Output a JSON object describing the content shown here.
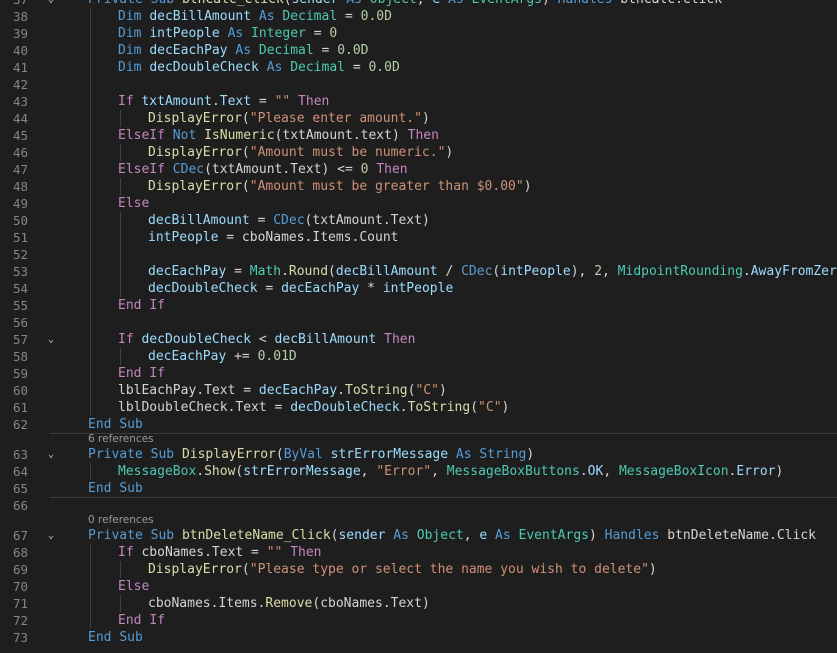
{
  "editor": {
    "lines": [
      {
        "kind": "code",
        "ln": "37",
        "fold": "v",
        "indent": 1,
        "tokens": [
          [
            "kw",
            "Private"
          ],
          [
            "pl",
            " "
          ],
          [
            "kw",
            "Sub"
          ],
          [
            "pl",
            " "
          ],
          [
            "fn",
            "btnCalc_Click"
          ],
          [
            "pl",
            "("
          ],
          [
            "var",
            "sender"
          ],
          [
            "pl",
            " "
          ],
          [
            "kw",
            "As"
          ],
          [
            "pl",
            " "
          ],
          [
            "ty",
            "Object"
          ],
          [
            "pl",
            ", "
          ],
          [
            "var",
            "e"
          ],
          [
            "pl",
            " "
          ],
          [
            "kw",
            "As"
          ],
          [
            "pl",
            " "
          ],
          [
            "ty",
            "EventArgs"
          ],
          [
            "pl",
            ") "
          ],
          [
            "kw",
            "Handles"
          ],
          [
            "pl",
            " btnCalc.Click"
          ]
        ]
      },
      {
        "kind": "code",
        "ln": "38",
        "fold": "",
        "indent": 2,
        "tokens": [
          [
            "kw",
            "Dim"
          ],
          [
            "pl",
            " "
          ],
          [
            "var",
            "decBillAmount"
          ],
          [
            "pl",
            " "
          ],
          [
            "kw",
            "As"
          ],
          [
            "pl",
            " "
          ],
          [
            "ty",
            "Decimal"
          ],
          [
            "pl",
            " = "
          ],
          [
            "num",
            "0.0D"
          ]
        ]
      },
      {
        "kind": "code",
        "ln": "39",
        "fold": "",
        "indent": 2,
        "tokens": [
          [
            "kw",
            "Dim"
          ],
          [
            "pl",
            " "
          ],
          [
            "var",
            "intPeople"
          ],
          [
            "pl",
            " "
          ],
          [
            "kw",
            "As"
          ],
          [
            "pl",
            " "
          ],
          [
            "ty",
            "Integer"
          ],
          [
            "pl",
            " = "
          ],
          [
            "num",
            "0"
          ]
        ]
      },
      {
        "kind": "code",
        "ln": "40",
        "fold": "",
        "indent": 2,
        "tokens": [
          [
            "kw",
            "Dim"
          ],
          [
            "pl",
            " "
          ],
          [
            "var",
            "decEachPay"
          ],
          [
            "pl",
            " "
          ],
          [
            "kw",
            "As"
          ],
          [
            "pl",
            " "
          ],
          [
            "ty",
            "Decimal"
          ],
          [
            "pl",
            " = "
          ],
          [
            "num",
            "0.0D"
          ]
        ]
      },
      {
        "kind": "code",
        "ln": "41",
        "fold": "",
        "indent": 2,
        "tokens": [
          [
            "kw",
            "Dim"
          ],
          [
            "pl",
            " "
          ],
          [
            "var",
            "decDoubleCheck"
          ],
          [
            "pl",
            " "
          ],
          [
            "kw",
            "As"
          ],
          [
            "pl",
            " "
          ],
          [
            "ty",
            "Decimal"
          ],
          [
            "pl",
            " = "
          ],
          [
            "num",
            "0.0D"
          ]
        ]
      },
      {
        "kind": "code",
        "ln": "42",
        "fold": "",
        "indent": 2,
        "tokens": []
      },
      {
        "kind": "code",
        "ln": "43",
        "fold": "",
        "indent": 2,
        "tokens": [
          [
            "ctl",
            "If"
          ],
          [
            "pl",
            " "
          ],
          [
            "var",
            "txtAmount"
          ],
          [
            "pl",
            "."
          ],
          [
            "var",
            "Text"
          ],
          [
            "pl",
            " = "
          ],
          [
            "str",
            "\"\""
          ],
          [
            "pl",
            " "
          ],
          [
            "ctl",
            "Then"
          ]
        ]
      },
      {
        "kind": "code",
        "ln": "44",
        "fold": "",
        "indent": 3,
        "tokens": [
          [
            "fn",
            "DisplayError"
          ],
          [
            "pl",
            "("
          ],
          [
            "str",
            "\"Please enter amount.\""
          ],
          [
            "pl",
            ")"
          ]
        ]
      },
      {
        "kind": "code",
        "ln": "45",
        "fold": "",
        "indent": 2,
        "tokens": [
          [
            "ctl",
            "ElseIf"
          ],
          [
            "pl",
            " "
          ],
          [
            "kw",
            "Not"
          ],
          [
            "pl",
            " "
          ],
          [
            "fn",
            "IsNumeric"
          ],
          [
            "pl",
            "(txtAmount.text) "
          ],
          [
            "ctl",
            "Then"
          ]
        ]
      },
      {
        "kind": "code",
        "ln": "46",
        "fold": "",
        "indent": 3,
        "tokens": [
          [
            "fn",
            "DisplayError"
          ],
          [
            "pl",
            "("
          ],
          [
            "str",
            "\"Amount must be numeric.\""
          ],
          [
            "pl",
            ")"
          ]
        ]
      },
      {
        "kind": "code",
        "ln": "47",
        "fold": "",
        "indent": 2,
        "tokens": [
          [
            "ctl",
            "ElseIf"
          ],
          [
            "pl",
            " "
          ],
          [
            "kw",
            "CDec"
          ],
          [
            "pl",
            "(txtAmount.Text) <= "
          ],
          [
            "num",
            "0"
          ],
          [
            "pl",
            " "
          ],
          [
            "ctl",
            "Then"
          ]
        ]
      },
      {
        "kind": "code",
        "ln": "48",
        "fold": "",
        "indent": 3,
        "tokens": [
          [
            "fn",
            "DisplayError"
          ],
          [
            "pl",
            "("
          ],
          [
            "str",
            "\"Amount must be greater than $0.00\""
          ],
          [
            "pl",
            ")"
          ]
        ]
      },
      {
        "kind": "code",
        "ln": "49",
        "fold": "",
        "indent": 2,
        "tokens": [
          [
            "ctl",
            "Else"
          ]
        ]
      },
      {
        "kind": "code",
        "ln": "50",
        "fold": "",
        "indent": 3,
        "tokens": [
          [
            "var",
            "decBillAmount"
          ],
          [
            "pl",
            " = "
          ],
          [
            "kw",
            "CDec"
          ],
          [
            "pl",
            "(txtAmount.Text)"
          ]
        ]
      },
      {
        "kind": "code",
        "ln": "51",
        "fold": "",
        "indent": 3,
        "tokens": [
          [
            "var",
            "intPeople"
          ],
          [
            "pl",
            " = cboNames.Items.Count"
          ]
        ]
      },
      {
        "kind": "code",
        "ln": "52",
        "fold": "",
        "indent": 3,
        "tokens": []
      },
      {
        "kind": "code",
        "ln": "53",
        "fold": "",
        "indent": 3,
        "tokens": [
          [
            "var",
            "decEachPay"
          ],
          [
            "pl",
            " = "
          ],
          [
            "ty",
            "Math"
          ],
          [
            "pl",
            "."
          ],
          [
            "fn",
            "Round"
          ],
          [
            "pl",
            "("
          ],
          [
            "var",
            "decBillAmount"
          ],
          [
            "pl",
            " / "
          ],
          [
            "kw",
            "CDec"
          ],
          [
            "pl",
            "("
          ],
          [
            "var",
            "intPeople"
          ],
          [
            "pl",
            "), "
          ],
          [
            "num",
            "2"
          ],
          [
            "pl",
            ", "
          ],
          [
            "ty",
            "MidpointRounding"
          ],
          [
            "pl",
            "."
          ],
          [
            "var",
            "AwayFromZero"
          ],
          [
            "pl",
            ")"
          ]
        ]
      },
      {
        "kind": "code",
        "ln": "54",
        "fold": "",
        "indent": 3,
        "tokens": [
          [
            "var",
            "decDoubleCheck"
          ],
          [
            "pl",
            " = "
          ],
          [
            "var",
            "decEachPay"
          ],
          [
            "pl",
            " * "
          ],
          [
            "var",
            "intPeople"
          ]
        ]
      },
      {
        "kind": "code",
        "ln": "55",
        "fold": "",
        "indent": 2,
        "tokens": [
          [
            "ctl",
            "End"
          ],
          [
            "pl",
            " "
          ],
          [
            "ctl",
            "If"
          ]
        ]
      },
      {
        "kind": "code",
        "ln": "56",
        "fold": "",
        "indent": 2,
        "tokens": []
      },
      {
        "kind": "code",
        "ln": "57",
        "fold": "v",
        "indent": 2,
        "tokens": [
          [
            "ctl",
            "If"
          ],
          [
            "pl",
            " "
          ],
          [
            "var",
            "decDoubleCheck"
          ],
          [
            "pl",
            " < "
          ],
          [
            "var",
            "decBillAmount"
          ],
          [
            "pl",
            " "
          ],
          [
            "ctl",
            "Then"
          ]
        ]
      },
      {
        "kind": "code",
        "ln": "58",
        "fold": "",
        "indent": 3,
        "tokens": [
          [
            "var",
            "decEachPay"
          ],
          [
            "pl",
            " += "
          ],
          [
            "num",
            "0.01D"
          ]
        ]
      },
      {
        "kind": "code",
        "ln": "59",
        "fold": "",
        "indent": 2,
        "tokens": [
          [
            "ctl",
            "End"
          ],
          [
            "pl",
            " "
          ],
          [
            "ctl",
            "If"
          ]
        ]
      },
      {
        "kind": "code",
        "ln": "60",
        "fold": "",
        "indent": 2,
        "tokens": [
          [
            "pl",
            "lblEachPay.Text = "
          ],
          [
            "var",
            "decEachPay"
          ],
          [
            "pl",
            "."
          ],
          [
            "fn",
            "ToString"
          ],
          [
            "pl",
            "("
          ],
          [
            "str",
            "\"C\""
          ],
          [
            "pl",
            ")"
          ]
        ]
      },
      {
        "kind": "code",
        "ln": "61",
        "fold": "",
        "indent": 2,
        "tokens": [
          [
            "pl",
            "lblDoubleCheck.Text = "
          ],
          [
            "var",
            "decDoubleCheck"
          ],
          [
            "pl",
            "."
          ],
          [
            "fn",
            "ToString"
          ],
          [
            "pl",
            "("
          ],
          [
            "str",
            "\"C\""
          ],
          [
            "pl",
            ")"
          ]
        ]
      },
      {
        "kind": "code",
        "ln": "62",
        "fold": "",
        "indent": 1,
        "tokens": [
          [
            "kw",
            "End"
          ],
          [
            "pl",
            " "
          ],
          [
            "kw",
            "Sub"
          ]
        ]
      },
      {
        "kind": "lens",
        "ln": "",
        "fold": "",
        "indent": 1,
        "text": "6 references",
        "sep": true
      },
      {
        "kind": "code",
        "ln": "63",
        "fold": "v",
        "indent": 1,
        "tokens": [
          [
            "kw",
            "Private"
          ],
          [
            "pl",
            " "
          ],
          [
            "kw",
            "Sub"
          ],
          [
            "pl",
            " "
          ],
          [
            "fn",
            "DisplayError"
          ],
          [
            "pl",
            "("
          ],
          [
            "kw",
            "ByVal"
          ],
          [
            "pl",
            " "
          ],
          [
            "var",
            "strErrorMessage"
          ],
          [
            "pl",
            " "
          ],
          [
            "kw",
            "As"
          ],
          [
            "pl",
            " "
          ],
          [
            "kw",
            "String"
          ],
          [
            "pl",
            ")"
          ]
        ]
      },
      {
        "kind": "code",
        "ln": "64",
        "fold": "",
        "indent": 2,
        "tokens": [
          [
            "ty",
            "MessageBox"
          ],
          [
            "pl",
            "."
          ],
          [
            "fn",
            "Show"
          ],
          [
            "pl",
            "("
          ],
          [
            "var",
            "strErrorMessage"
          ],
          [
            "pl",
            ", "
          ],
          [
            "str",
            "\"Error\""
          ],
          [
            "pl",
            ", "
          ],
          [
            "ty",
            "MessageBoxButtons"
          ],
          [
            "pl",
            "."
          ],
          [
            "var",
            "OK"
          ],
          [
            "pl",
            ", "
          ],
          [
            "ty",
            "MessageBoxIcon"
          ],
          [
            "pl",
            "."
          ],
          [
            "var",
            "Error"
          ],
          [
            "pl",
            ")"
          ]
        ]
      },
      {
        "kind": "code",
        "ln": "65",
        "fold": "",
        "indent": 1,
        "tokens": [
          [
            "kw",
            "End"
          ],
          [
            "pl",
            " "
          ],
          [
            "kw",
            "Sub"
          ]
        ]
      },
      {
        "kind": "code",
        "ln": "66",
        "fold": "",
        "indent": 0,
        "tokens": [],
        "sep": true
      },
      {
        "kind": "lens",
        "ln": "",
        "fold": "",
        "indent": 1,
        "text": "0 references"
      },
      {
        "kind": "code",
        "ln": "67",
        "fold": "v",
        "indent": 1,
        "tokens": [
          [
            "kw",
            "Private"
          ],
          [
            "pl",
            " "
          ],
          [
            "kw",
            "Sub"
          ],
          [
            "pl",
            " "
          ],
          [
            "fn",
            "btnDeleteName_Click"
          ],
          [
            "pl",
            "("
          ],
          [
            "var",
            "sender"
          ],
          [
            "pl",
            " "
          ],
          [
            "kw",
            "As"
          ],
          [
            "pl",
            " "
          ],
          [
            "ty",
            "Object"
          ],
          [
            "pl",
            ", "
          ],
          [
            "var",
            "e"
          ],
          [
            "pl",
            " "
          ],
          [
            "kw",
            "As"
          ],
          [
            "pl",
            " "
          ],
          [
            "ty",
            "EventArgs"
          ],
          [
            "pl",
            ") "
          ],
          [
            "kw",
            "Handles"
          ],
          [
            "pl",
            " btnDeleteName.Click"
          ]
        ]
      },
      {
        "kind": "code",
        "ln": "68",
        "fold": "",
        "indent": 2,
        "tokens": [
          [
            "ctl",
            "If"
          ],
          [
            "pl",
            " cboNames.Text = "
          ],
          [
            "str",
            "\"\""
          ],
          [
            "pl",
            " "
          ],
          [
            "ctl",
            "Then"
          ]
        ]
      },
      {
        "kind": "code",
        "ln": "69",
        "fold": "",
        "indent": 3,
        "tokens": [
          [
            "fn",
            "DisplayError"
          ],
          [
            "pl",
            "("
          ],
          [
            "str",
            "\"Please type or select the name you wish to delete\""
          ],
          [
            "pl",
            ")"
          ]
        ]
      },
      {
        "kind": "code",
        "ln": "70",
        "fold": "",
        "indent": 2,
        "tokens": [
          [
            "ctl",
            "Else"
          ]
        ]
      },
      {
        "kind": "code",
        "ln": "71",
        "fold": "",
        "indent": 3,
        "tokens": [
          [
            "pl",
            "cboNames.Items."
          ],
          [
            "fn",
            "Remove"
          ],
          [
            "pl",
            "(cboNames.Text)"
          ]
        ]
      },
      {
        "kind": "code",
        "ln": "72",
        "fold": "",
        "indent": 2,
        "tokens": [
          [
            "ctl",
            "End"
          ],
          [
            "pl",
            " "
          ],
          [
            "ctl",
            "If"
          ]
        ]
      },
      {
        "kind": "code",
        "ln": "73",
        "fold": "",
        "indent": 1,
        "tokens": [
          [
            "kw",
            "End"
          ],
          [
            "pl",
            " "
          ],
          [
            "kw",
            "Sub"
          ]
        ]
      }
    ]
  }
}
